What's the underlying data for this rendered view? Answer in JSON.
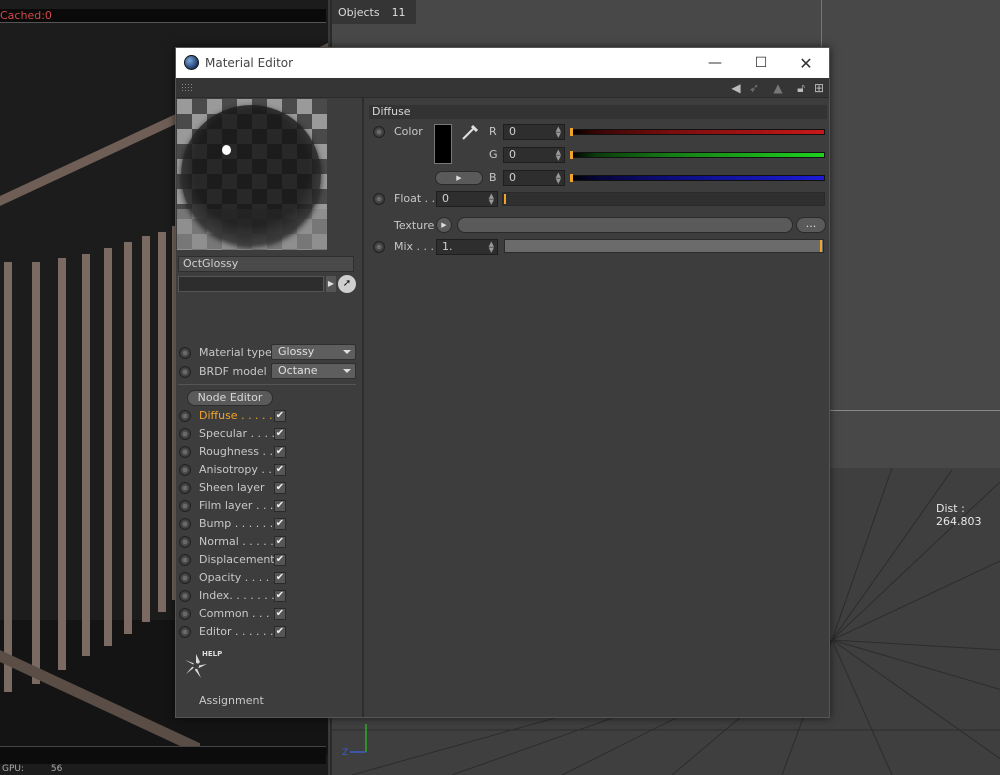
{
  "left_viewport": {
    "cached_text": "Cached:0",
    "gpu_label": "GPU:",
    "gpu_value": "56"
  },
  "right_viewport": {
    "objects_label": "Objects",
    "objects_count": "11",
    "dist_text": "Dist : 264.803"
  },
  "window": {
    "title": "Material Editor",
    "minimize_glyph": "—",
    "maximize_glyph": "☐",
    "close_glyph": "✕"
  },
  "toolbar": {
    "icons": [
      "arrow-left-icon",
      "arrow-right-icon",
      "arrow-up-icon",
      "lock-icon",
      "new-panel-icon"
    ]
  },
  "material": {
    "name": "OctGlossy",
    "material_type_label": "Material type",
    "material_type_value": "Glossy",
    "brdf_model_label": "BRDF model",
    "brdf_model_value": "Octane",
    "node_editor_label": "Node Editor",
    "assignment_label": "Assignment",
    "help_label": "HELP"
  },
  "channels": [
    {
      "label": "Diffuse . . . . .",
      "active": true
    },
    {
      "label": "Specular . . . .",
      "active": false
    },
    {
      "label": "Roughness . .",
      "active": false
    },
    {
      "label": "Anisotropy . .",
      "active": false
    },
    {
      "label": "Sheen layer",
      "active": false
    },
    {
      "label": "Film layer . . .",
      "active": false
    },
    {
      "label": "Bump . . . . . .",
      "active": false
    },
    {
      "label": "Normal . . . . .",
      "active": false
    },
    {
      "label": "Displacement",
      "active": false
    },
    {
      "label": "Opacity . . . . .",
      "active": false
    },
    {
      "label": "Index. . . . . . .",
      "active": false
    },
    {
      "label": "Common . . . .",
      "active": false
    },
    {
      "label": "Editor . . . . . .",
      "active": false
    }
  ],
  "diffuse": {
    "section_title": "Diffuse",
    "color_label": "Color",
    "r_label": "R",
    "r_value": "0",
    "g_label": "G",
    "g_value": "0",
    "b_label": "B",
    "b_value": "0",
    "float_label": "Float . .",
    "float_value": "0",
    "texture_label": "Texture",
    "texture_more": "...",
    "mix_label": "Mix . . .",
    "mix_value": "1.",
    "swatch_color": "#000000"
  },
  "colors": {
    "accent": "#f0a429",
    "red_channel": "#c81919",
    "green_channel": "#1fd11f",
    "blue_channel": "#1b1bd8"
  }
}
